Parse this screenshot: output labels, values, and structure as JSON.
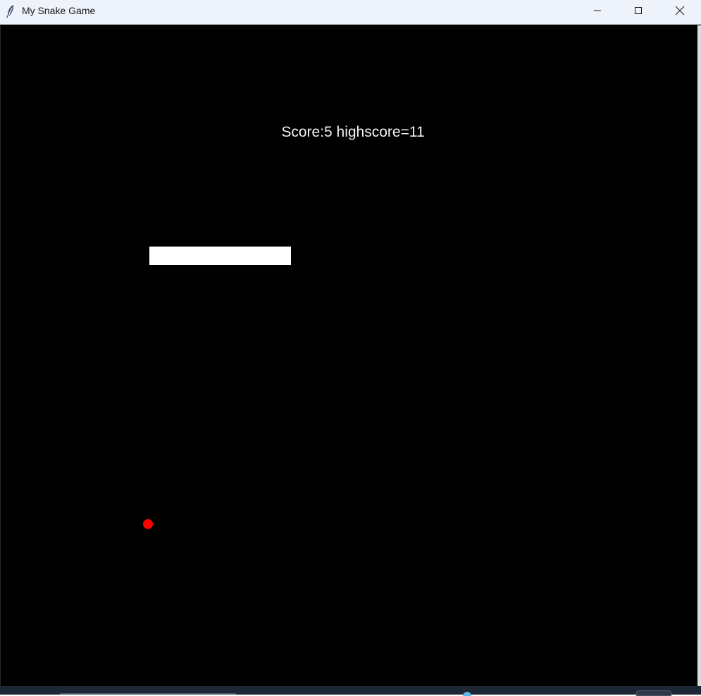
{
  "window": {
    "title": "My Snake Game",
    "app_icon": "feather-icon",
    "controls": {
      "minimize_icon": "minimize-icon",
      "maximize_icon": "maximize-icon",
      "close_icon": "close-icon"
    }
  },
  "game": {
    "score_text": "Score:5 highscore=11",
    "score": 5,
    "highscore": 11,
    "snake_color": "#ffffff",
    "food_color": "#ff0000",
    "background_color": "#000000"
  }
}
